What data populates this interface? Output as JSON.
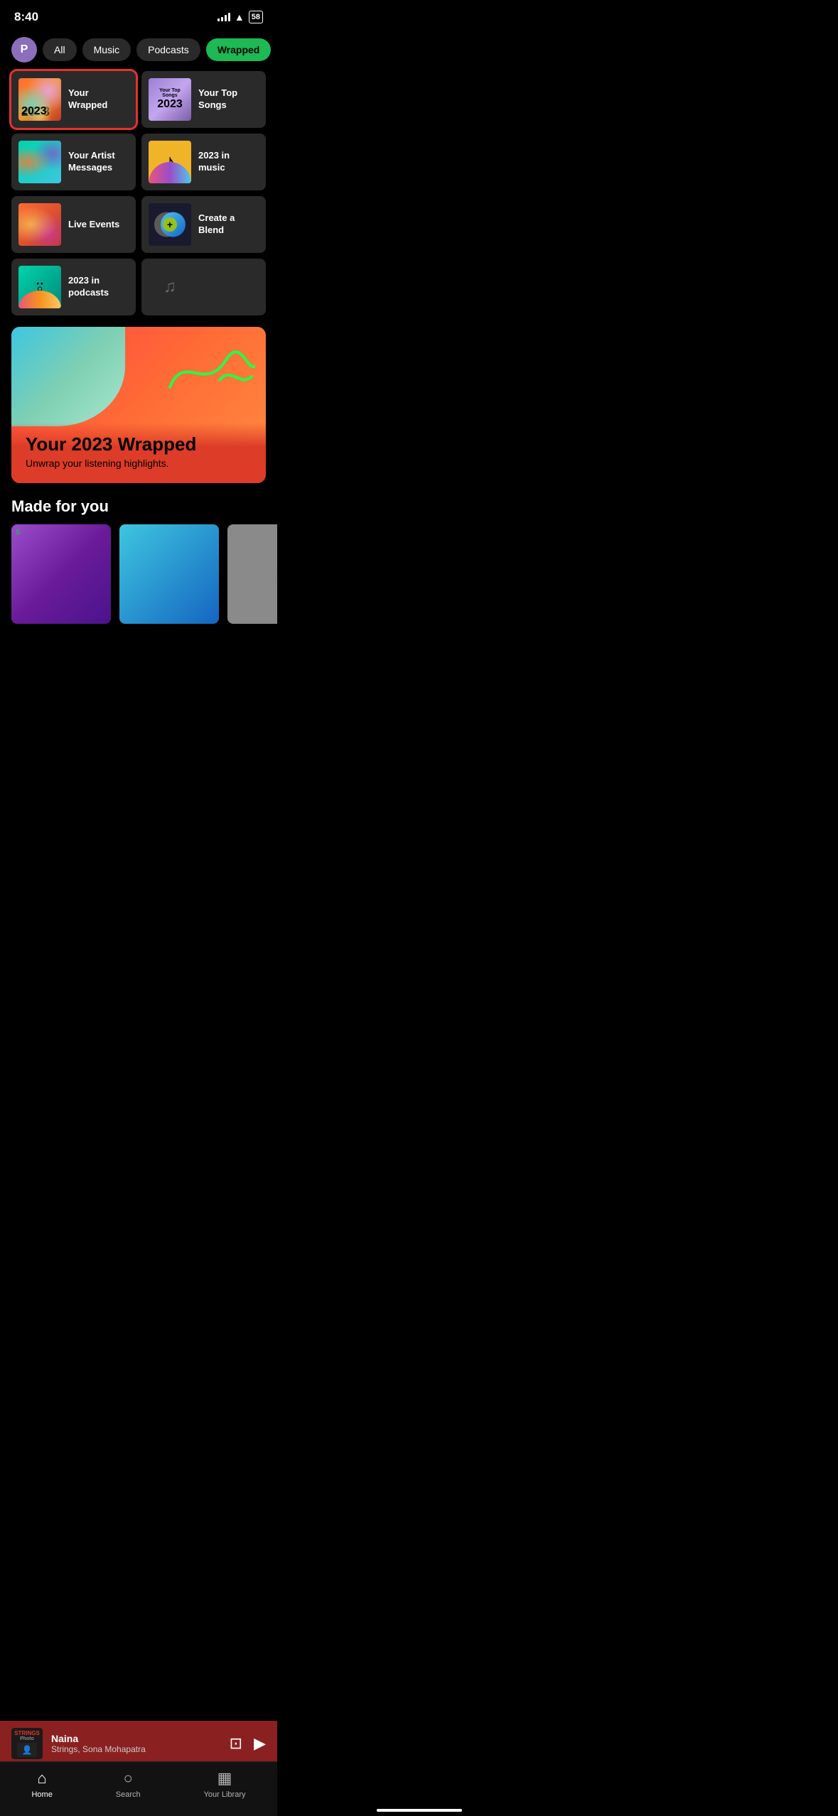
{
  "statusBar": {
    "time": "8:40",
    "battery": "58"
  },
  "filterBar": {
    "avatar": "P",
    "pills": [
      {
        "id": "all",
        "label": "All",
        "active": false
      },
      {
        "id": "music",
        "label": "Music",
        "active": false
      },
      {
        "id": "podcasts",
        "label": "Podcasts",
        "active": false
      },
      {
        "id": "wrapped",
        "label": "Wrapped",
        "active": true
      }
    ]
  },
  "cards": [
    {
      "id": "your-wrapped",
      "label": "Your Wrapped",
      "selected": true
    },
    {
      "id": "your-top-songs",
      "label": "Your Top Songs",
      "selected": false
    },
    {
      "id": "your-artist-messages",
      "label": "Your Artist Messages",
      "selected": false
    },
    {
      "id": "2023-in-music",
      "label": "2023 in music",
      "selected": false
    },
    {
      "id": "live-events",
      "label": "Live Events",
      "selected": false
    },
    {
      "id": "create-a-blend",
      "label": "Create a Blend",
      "selected": false
    },
    {
      "id": "2023-in-podcasts",
      "label": "2023 in podcasts",
      "selected": false
    },
    {
      "id": "empty",
      "label": "",
      "selected": false
    }
  ],
  "banner": {
    "title": "Your 2023 Wrapped",
    "subtitle": "Unwrap your listening highlights."
  },
  "madeForYou": {
    "title": "Made for you"
  },
  "nowPlaying": {
    "albumLabel": "STRINGS Photo",
    "title": "Naina",
    "artist": "Strings, Sona Mohapatra"
  },
  "bottomNav": {
    "items": [
      {
        "id": "home",
        "label": "Home",
        "active": true,
        "icon": "⌂"
      },
      {
        "id": "search",
        "label": "Search",
        "active": false,
        "icon": "○"
      },
      {
        "id": "library",
        "label": "Your Library",
        "active": false,
        "icon": "▦"
      }
    ]
  }
}
